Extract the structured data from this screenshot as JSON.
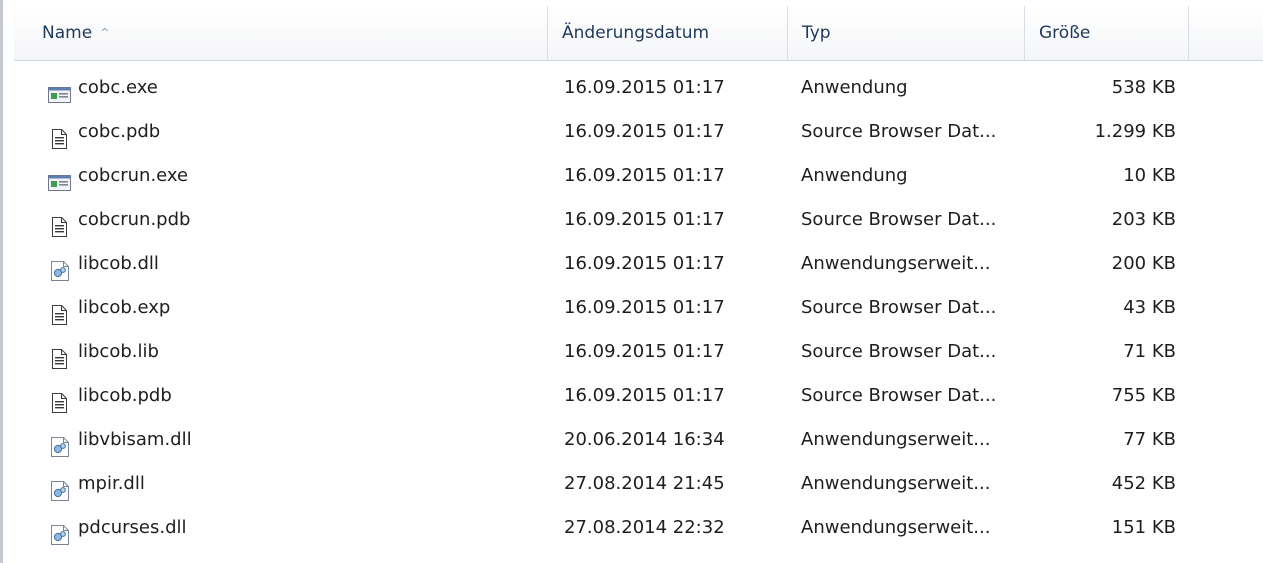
{
  "columns": {
    "name": "Name",
    "date": "Änderungsdatum",
    "type": "Typ",
    "size": "Größe",
    "sort_indicator": "^"
  },
  "files": [
    {
      "name": "cobc.exe",
      "date": "16.09.2015 01:17",
      "type": "Anwendung",
      "size": "538 KB",
      "icon": "exe-icon"
    },
    {
      "name": "cobc.pdb",
      "date": "16.09.2015 01:17",
      "type": "Source Browser Dat...",
      "size": "1.299 KB",
      "icon": "document-icon"
    },
    {
      "name": "cobcrun.exe",
      "date": "16.09.2015 01:17",
      "type": "Anwendung",
      "size": "10 KB",
      "icon": "exe-icon"
    },
    {
      "name": "cobcrun.pdb",
      "date": "16.09.2015 01:17",
      "type": "Source Browser Dat...",
      "size": "203 KB",
      "icon": "document-icon"
    },
    {
      "name": "libcob.dll",
      "date": "16.09.2015 01:17",
      "type": "Anwendungserweit...",
      "size": "200 KB",
      "icon": "dll-icon"
    },
    {
      "name": "libcob.exp",
      "date": "16.09.2015 01:17",
      "type": "Source Browser Dat...",
      "size": "43 KB",
      "icon": "document-icon"
    },
    {
      "name": "libcob.lib",
      "date": "16.09.2015 01:17",
      "type": "Source Browser Dat...",
      "size": "71 KB",
      "icon": "document-icon"
    },
    {
      "name": "libcob.pdb",
      "date": "16.09.2015 01:17",
      "type": "Source Browser Dat...",
      "size": "755 KB",
      "icon": "document-icon"
    },
    {
      "name": "libvbisam.dll",
      "date": "20.06.2014 16:34",
      "type": "Anwendungserweit...",
      "size": "77 KB",
      "icon": "dll-icon"
    },
    {
      "name": "mpir.dll",
      "date": "27.08.2014 21:45",
      "type": "Anwendungserweit...",
      "size": "452 KB",
      "icon": "dll-icon"
    },
    {
      "name": "pdcurses.dll",
      "date": "27.08.2014 22:32",
      "type": "Anwendungserweit...",
      "size": "151 KB",
      "icon": "dll-icon"
    }
  ]
}
